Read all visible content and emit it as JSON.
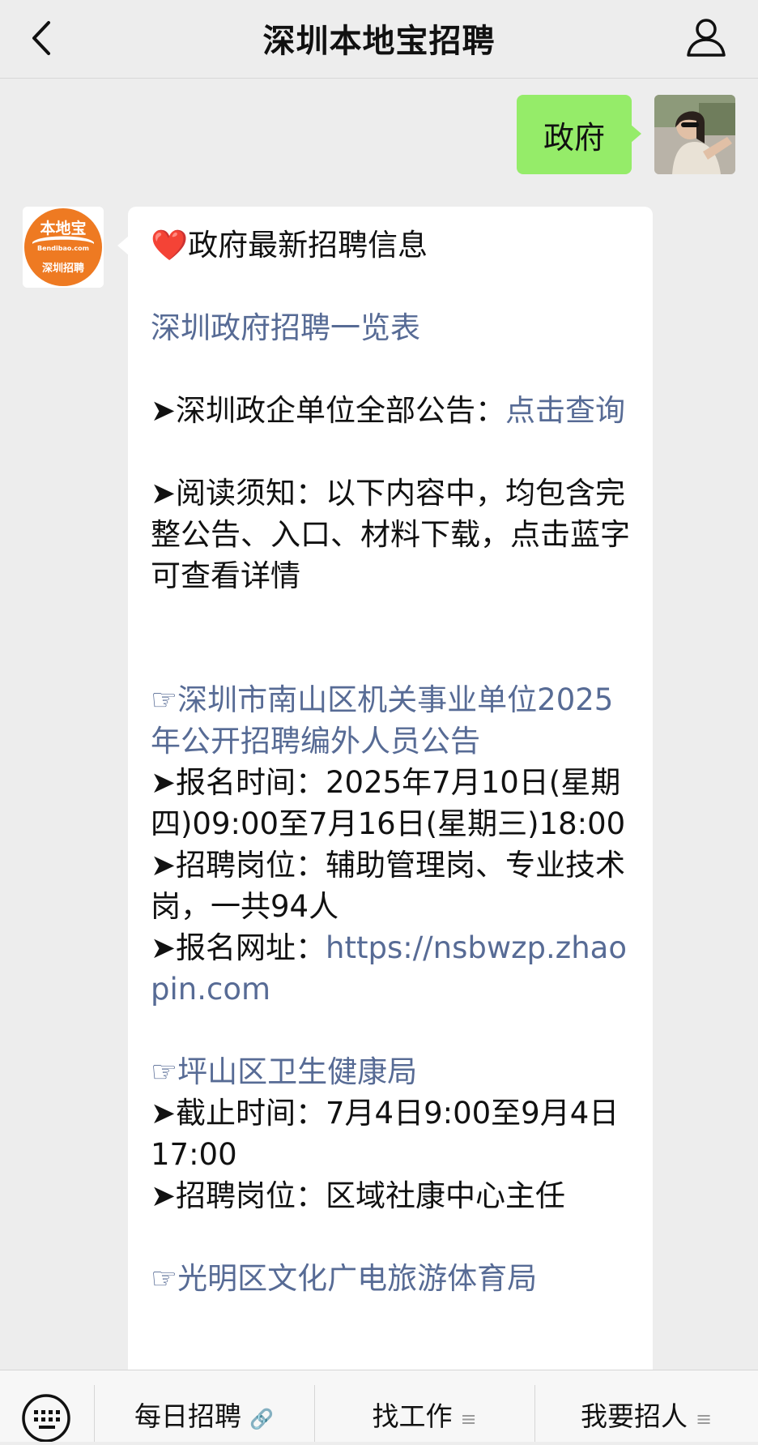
{
  "header": {
    "title": "深圳本地宝招聘"
  },
  "chat": {
    "user_message": "政府",
    "bot_logo": {
      "brand": "本地宝",
      "domain": "Bendibao.com",
      "sub": "深圳招聘"
    },
    "bot_message": {
      "heart": "❤️",
      "heading": "政府最新招聘信息",
      "list_link": "深圳政府招聘一览表",
      "notice_prefix": "➤深圳政企单位全部公告：",
      "notice_link": "点击查询",
      "reading_notice": "➤阅读须知：以下内容中，均包含完整公告、入口、材料下载，点击蓝字可查看详情",
      "pointer": "☞",
      "job1": {
        "title": "深圳市南山区机关事业单位2025年公开招聘编外人员公告",
        "time": "➤报名时间：2025年7月10日(星期四)09:00至7月16日(星期三)18:00",
        "positions": "➤招聘岗位：辅助管理岗、专业技术岗，一共94人",
        "url_prefix": "➤报名网址：",
        "url": "https://nsbwzp.zhaopin.com"
      },
      "job2": {
        "title": "坪山区卫生健康局",
        "deadline": "➤截止时间：7月4日9:00至9月4日17:00",
        "positions": "➤招聘岗位：区域社康中心主任"
      },
      "job3": {
        "title": "光明区文化广电旅游体育局"
      }
    }
  },
  "bottom_menu": {
    "items": [
      {
        "label": "每日招聘",
        "suffix_icon": "link-icon"
      },
      {
        "label": "找工作",
        "suffix_icon": "menu-lines-icon"
      },
      {
        "label": "我要招人",
        "suffix_icon": "menu-lines-icon"
      }
    ]
  }
}
